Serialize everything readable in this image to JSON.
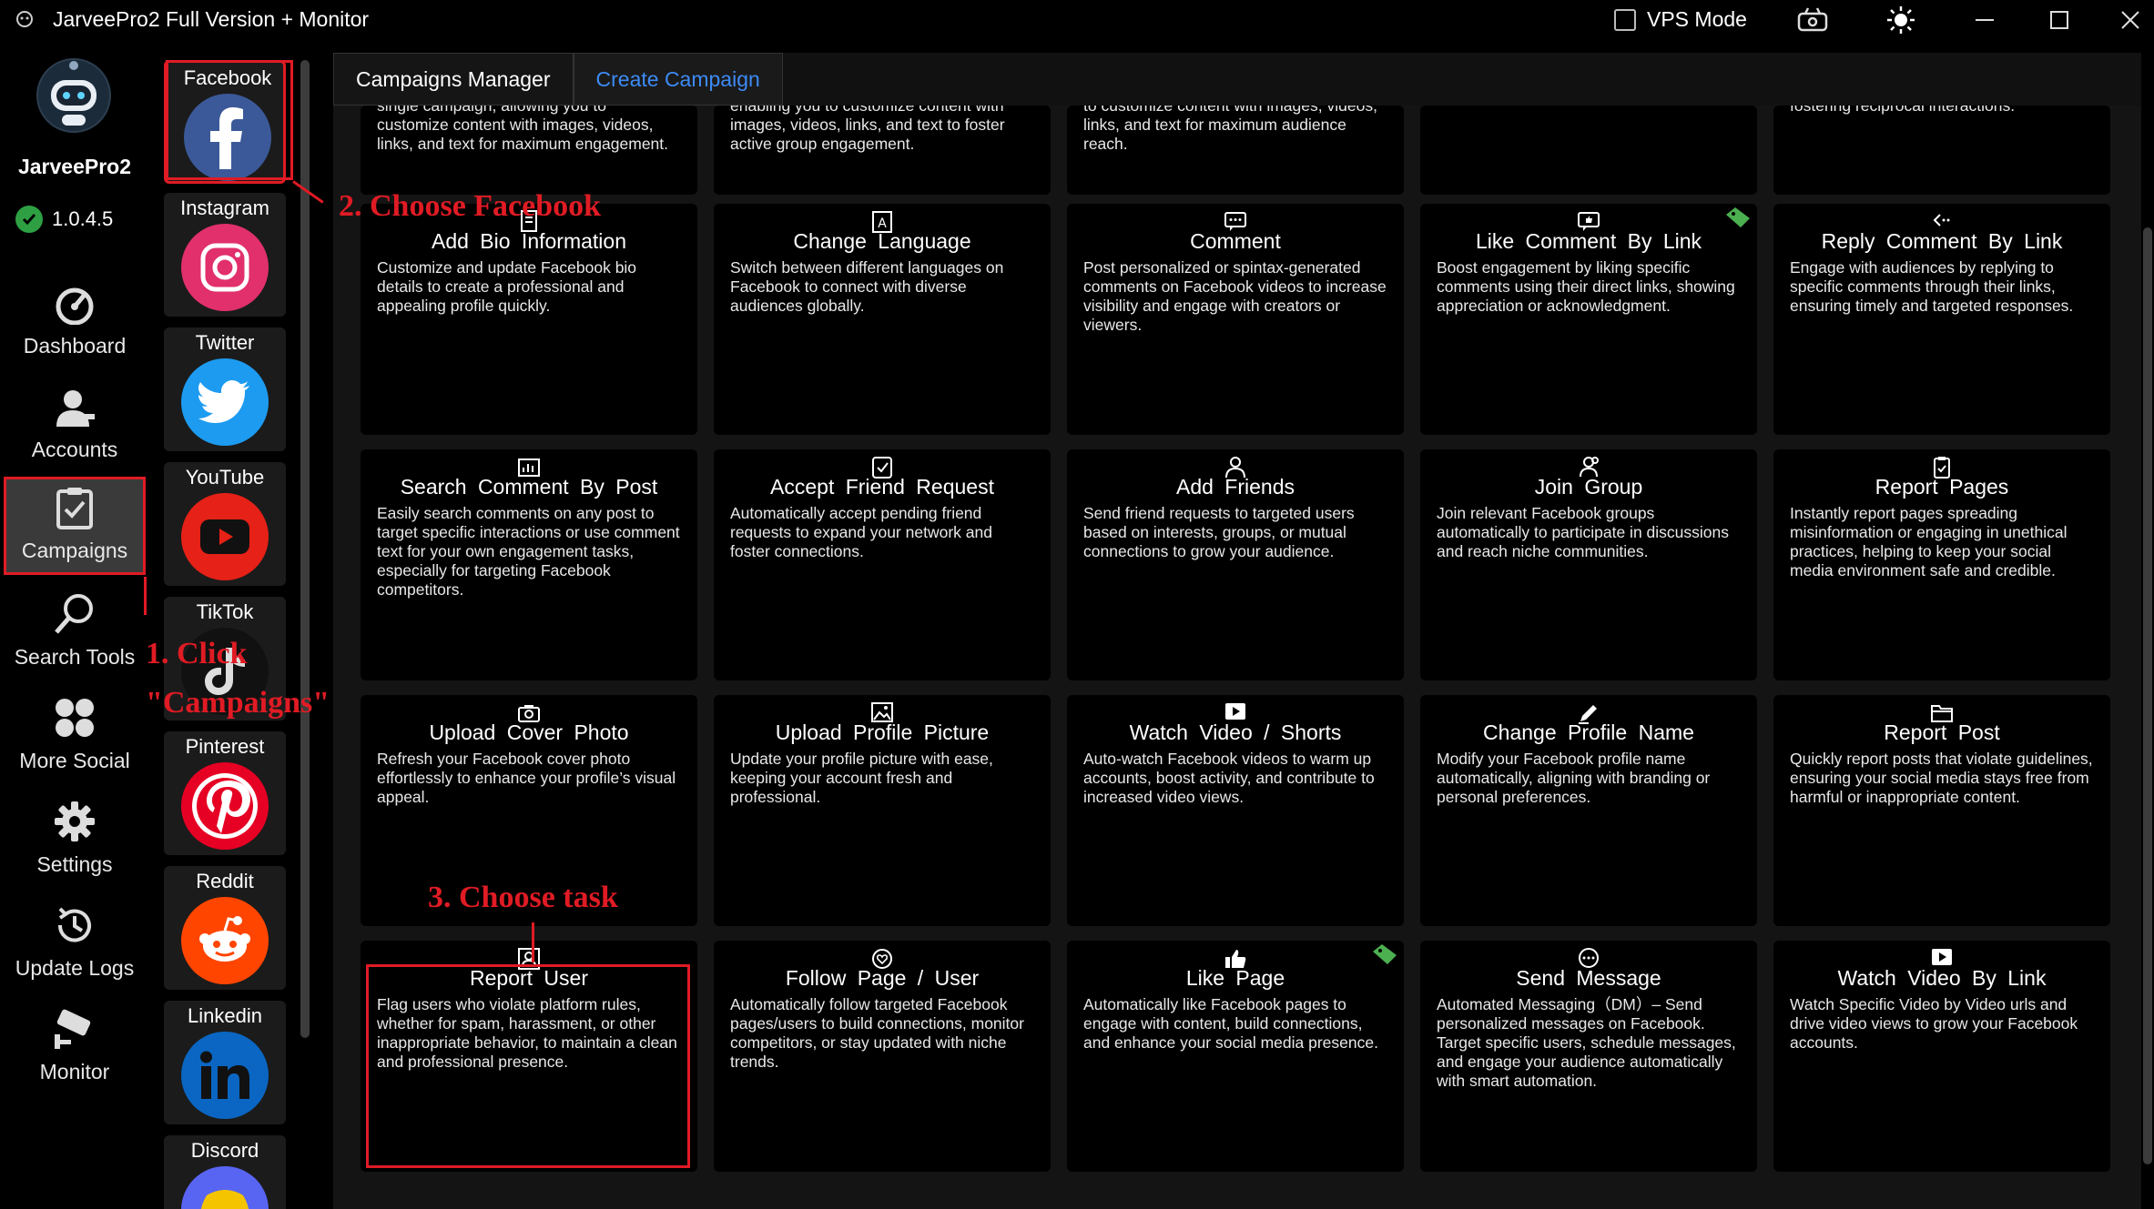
{
  "window": {
    "title": "JarveePro2 Full Version + Monitor",
    "vps_mode_label": "VPS Mode"
  },
  "sidebar": {
    "brand": "JarveePro2",
    "version": "1.0.4.5",
    "items": [
      {
        "label": "Dashboard",
        "icon": "gauge-icon"
      },
      {
        "label": "Accounts",
        "icon": "user-icon"
      },
      {
        "label": "Campaigns",
        "icon": "clipboard-check-icon"
      },
      {
        "label": "Search Tools",
        "icon": "search-icon"
      },
      {
        "label": "More Social",
        "icon": "apps-grid-icon"
      },
      {
        "label": "Settings",
        "icon": "gear-icon"
      },
      {
        "label": "Update Logs",
        "icon": "history-icon"
      },
      {
        "label": "Monitor",
        "icon": "camera-icon"
      }
    ]
  },
  "socials": [
    {
      "label": "Facebook",
      "color": "#3b5998"
    },
    {
      "label": "Instagram",
      "color": "#e1306c"
    },
    {
      "label": "Twitter",
      "color": "#1d9bf0"
    },
    {
      "label": "YouTube",
      "color": "#e62117"
    },
    {
      "label": "TikTok",
      "color": "#111111"
    },
    {
      "label": "Pinterest",
      "color": "#e60023"
    },
    {
      "label": "Reddit",
      "color": "#ff4500"
    },
    {
      "label": "Linkedin",
      "color": "#0a66c2"
    },
    {
      "label": "Discord",
      "color": "#5865f2"
    }
  ],
  "tabs": [
    "Campaigns Manager",
    "Create Campaign"
  ],
  "cards_top_partial": [
    "single campaign, allowing you to customize content with images, videos, links, and text for maximum engagement.",
    "enabling you to customize content with images, videos, links, and text to foster active group engagement.",
    "to customize content with images, videos, links, and text for maximum audience reach.",
    "",
    "fostering reciprocal interactions."
  ],
  "cards": [
    {
      "title": "Add Bio Information",
      "desc": "Customize and update Facebook bio details to create a professional and appealing profile quickly.",
      "icon": "document-icon"
    },
    {
      "title": "Change Language",
      "desc": "Switch between different languages on Facebook to connect with diverse audiences globally.",
      "icon": "language-icon"
    },
    {
      "title": "Comment",
      "desc": "Post personalized or spintax-generated comments on Facebook videos to increase visibility and engage with creators or viewers.",
      "icon": "comment-icon"
    },
    {
      "title": "Like Comment By Link",
      "desc": "Boost engagement by liking specific comments using their direct links, showing appreciation or acknowledgment.",
      "icon": "comment-like-icon",
      "free": true
    },
    {
      "title": "Reply Comment By Link",
      "desc": "Engage with audiences by replying to specific comments through their links, ensuring timely and targeted responses.",
      "icon": "reply-icon"
    },
    {
      "title": "Search Comment By Post",
      "desc": "Easily search comments on any post to target specific interactions or use comment text for your own engagement tasks, especially for targeting Facebook competitors.",
      "icon": "search-chart-icon"
    },
    {
      "title": "Accept Friend Request",
      "desc": "Automatically accept pending friend requests to expand your network and foster connections.",
      "icon": "accept-icon"
    },
    {
      "title": "Add Friends",
      "desc": "Send friend requests to targeted users based on interests, groups, or mutual connections to grow your audience.",
      "icon": "add-user-icon"
    },
    {
      "title": "Join Group",
      "desc": "Join relevant Facebook groups automatically to participate in discussions and reach niche communities.",
      "icon": "group-icon"
    },
    {
      "title": "Report Pages",
      "desc": "Instantly report pages spreading misinformation or engaging in unethical practices, helping to keep your social media environment safe and credible.",
      "icon": "report-clipboard-icon"
    },
    {
      "title": "Upload Cover Photo",
      "desc": "Refresh your Facebook cover photo effortlessly to enhance your profile’s visual appeal.",
      "icon": "camera-icon"
    },
    {
      "title": "Upload Profile Picture",
      "desc": "Update your profile picture with ease, keeping your account fresh and professional.",
      "icon": "image-icon"
    },
    {
      "title": "Watch Video / Shorts",
      "desc": "Auto-watch Facebook videos to warm up accounts, boost activity, and contribute to increased video views.",
      "icon": "play-icon"
    },
    {
      "title": "Change Profile Name",
      "desc": "Modify your Facebook profile name automatically, aligning with branding or personal preferences.",
      "icon": "pencil-icon"
    },
    {
      "title": "Report Post",
      "desc": "Quickly report posts that violate guidelines, ensuring your social media stays free from harmful or inappropriate content.",
      "icon": "folder-icon"
    },
    {
      "title": "Report User",
      "desc": "Flag users who violate platform rules, whether for spam, harassment, or other inappropriate behavior, to maintain a clean and professional presence.",
      "icon": "user-card-icon"
    },
    {
      "title": "Follow Page / User",
      "desc": "Automatically follow targeted Facebook pages/users to build connections, monitor competitors, or stay updated with niche trends.",
      "icon": "follow-icon"
    },
    {
      "title": "Like Page",
      "desc": "Automatically like Facebook pages to engage with content, build connections, and enhance your social media presence.",
      "icon": "thumbs-up-icon",
      "free": true
    },
    {
      "title": "Send Message",
      "desc": "Automated Messaging（DM）– Send personalized messages on Facebook. Target specific users, schedule messages, and engage your audience automatically with smart automation.",
      "icon": "message-icon"
    },
    {
      "title": "Watch Video By Link",
      "desc": "Watch Specific Video by Video urls and drive video views to grow your Facebook accounts.",
      "icon": "play-icon"
    }
  ],
  "annotations": {
    "step1_a": "1. Click",
    "step1_b": "\"Campaigns\"",
    "step2": "2. Choose Facebook",
    "step3": "3. Choose task"
  },
  "colors": {
    "accent": "#3d8bf5",
    "annotation": "#e01b24",
    "free_tag": "#4caf50"
  }
}
